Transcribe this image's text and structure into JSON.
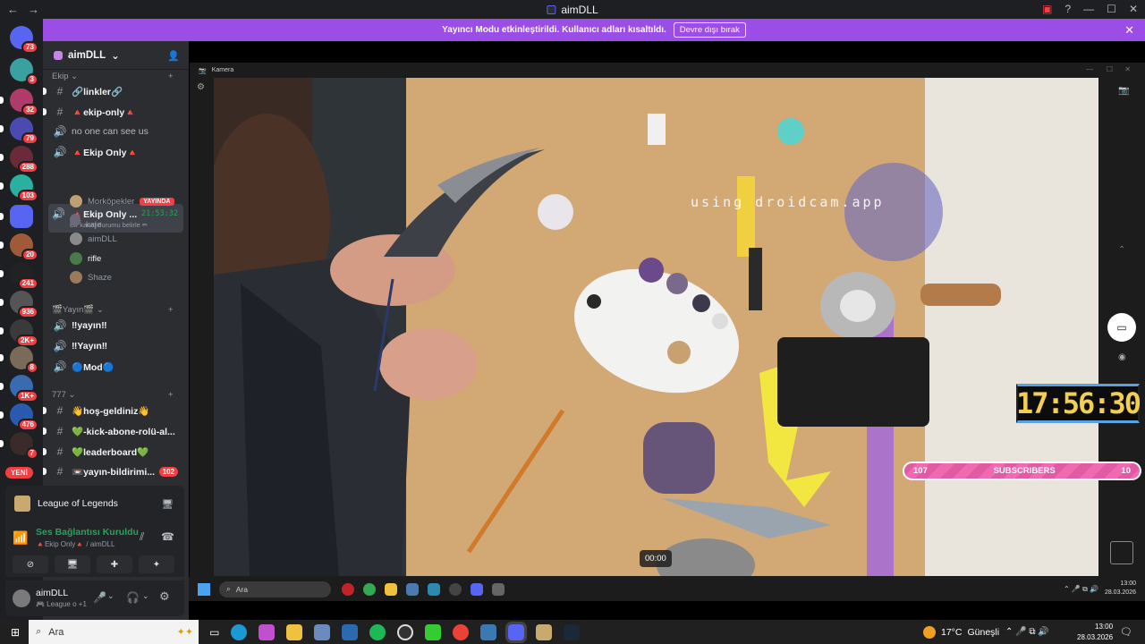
{
  "titlebar": {
    "title": "aimDLL"
  },
  "banner": {
    "text": "Yayıncı Modu etkinleştirildi. Kullanıcı adları kısaltıldı.",
    "button": "Devre dışı bırak"
  },
  "servers": [
    {
      "badge": "73",
      "color": "#5865f2"
    },
    {
      "badge": "3",
      "color": "#3aa0a0"
    },
    {
      "badge": "32",
      "color": "#b03a6a"
    },
    {
      "badge": "79",
      "color": "#4a4ab0"
    },
    {
      "badge": "288",
      "color": "#6a2a3a"
    },
    {
      "badge": "103",
      "color": "#2ab0a0"
    },
    {
      "badge": "",
      "color": "#5865f2"
    },
    {
      "badge": "20",
      "color": "#a05a3a"
    },
    {
      "badge": "241",
      "color": "#222222"
    },
    {
      "badge": "936",
      "color": "#555555"
    },
    {
      "badge": "2K+",
      "color": "#3a3a3a"
    },
    {
      "badge": "8",
      "color": "#7a6a5a"
    },
    {
      "badge": "1K+",
      "color": "#3a6ab0"
    },
    {
      "badge": "476",
      "color": "#2a5ab0"
    },
    {
      "badge": "7",
      "color": "#3a2a2a"
    }
  ],
  "yeni": "YENİ",
  "guild": {
    "name": "aimDLL"
  },
  "categories": {
    "ekip": "Ekip",
    "yayin": "🎬Yayın🎬",
    "c777": "777"
  },
  "channels": [
    {
      "sym": "#",
      "name": "🔗linkler🔗",
      "unread": true
    },
    {
      "sym": "#",
      "name": "🔺ekip-only🔺",
      "unread": true
    },
    {
      "sym": "🔊",
      "name": "no one can see us",
      "unread": false
    },
    {
      "sym": "🔊",
      "name": "🔺Ekip Only🔺",
      "unread": true
    }
  ],
  "active": {
    "name": "🔺Ekip Only ...",
    "time": "21:53:32",
    "status": "Bir kanal durumu belirle ✏"
  },
  "voice_users": [
    {
      "name": "Morköpekler",
      "live": "YAYINDA",
      "color": "#c0a070"
    },
    {
      "name": "! kaje",
      "live": "",
      "color": "#6a6a7a"
    },
    {
      "name": "aimDLL",
      "live": "",
      "color": "#8a8a8a"
    },
    {
      "name": "rifle",
      "live": "",
      "color": "#4a7a4a"
    },
    {
      "name": "Shaze",
      "live": "",
      "color": "#9a7a5a"
    }
  ],
  "channels2": [
    {
      "sym": "🔊",
      "name": "‼yayın‼"
    },
    {
      "sym": "🔊",
      "name": "‼Yayın‼"
    },
    {
      "sym": "🔊",
      "name": "🔵Mod🔵"
    }
  ],
  "channels3": [
    {
      "sym": "#",
      "name": "👋hoş-geldiniz👋",
      "count": ""
    },
    {
      "sym": "#",
      "name": "💚-kick-abone-rolü-al...",
      "count": ""
    },
    {
      "sym": "#",
      "name": "💚leaderboard💚",
      "count": ""
    },
    {
      "sym": "#",
      "name": "📼yayın-bildirimi...",
      "count": "102"
    }
  ],
  "game": {
    "name": "League of Legends"
  },
  "voice": {
    "status": "Ses Bağlantısı Kuruldu",
    "channel": "🔺Ekip Only🔺 / aimDLL"
  },
  "user": {
    "name": "aimDLL",
    "status": "🎮 League o +1"
  },
  "camera": {
    "title": "Kamera",
    "watermark": "using droidcam.app",
    "time": "00:00"
  },
  "overlay": {
    "timer": "17:56:30",
    "sub_left": "107",
    "sub_label": "SUBSCRIBERS",
    "sub_right": "10"
  },
  "inner_taskbar": {
    "search": "Ara",
    "time": "13:00",
    "date": "28.03.2026"
  },
  "taskbar": {
    "search": "Ara",
    "weather": "17°C",
    "weather_label": "Güneşli",
    "time": "13:00",
    "date": "28.03.2026"
  }
}
